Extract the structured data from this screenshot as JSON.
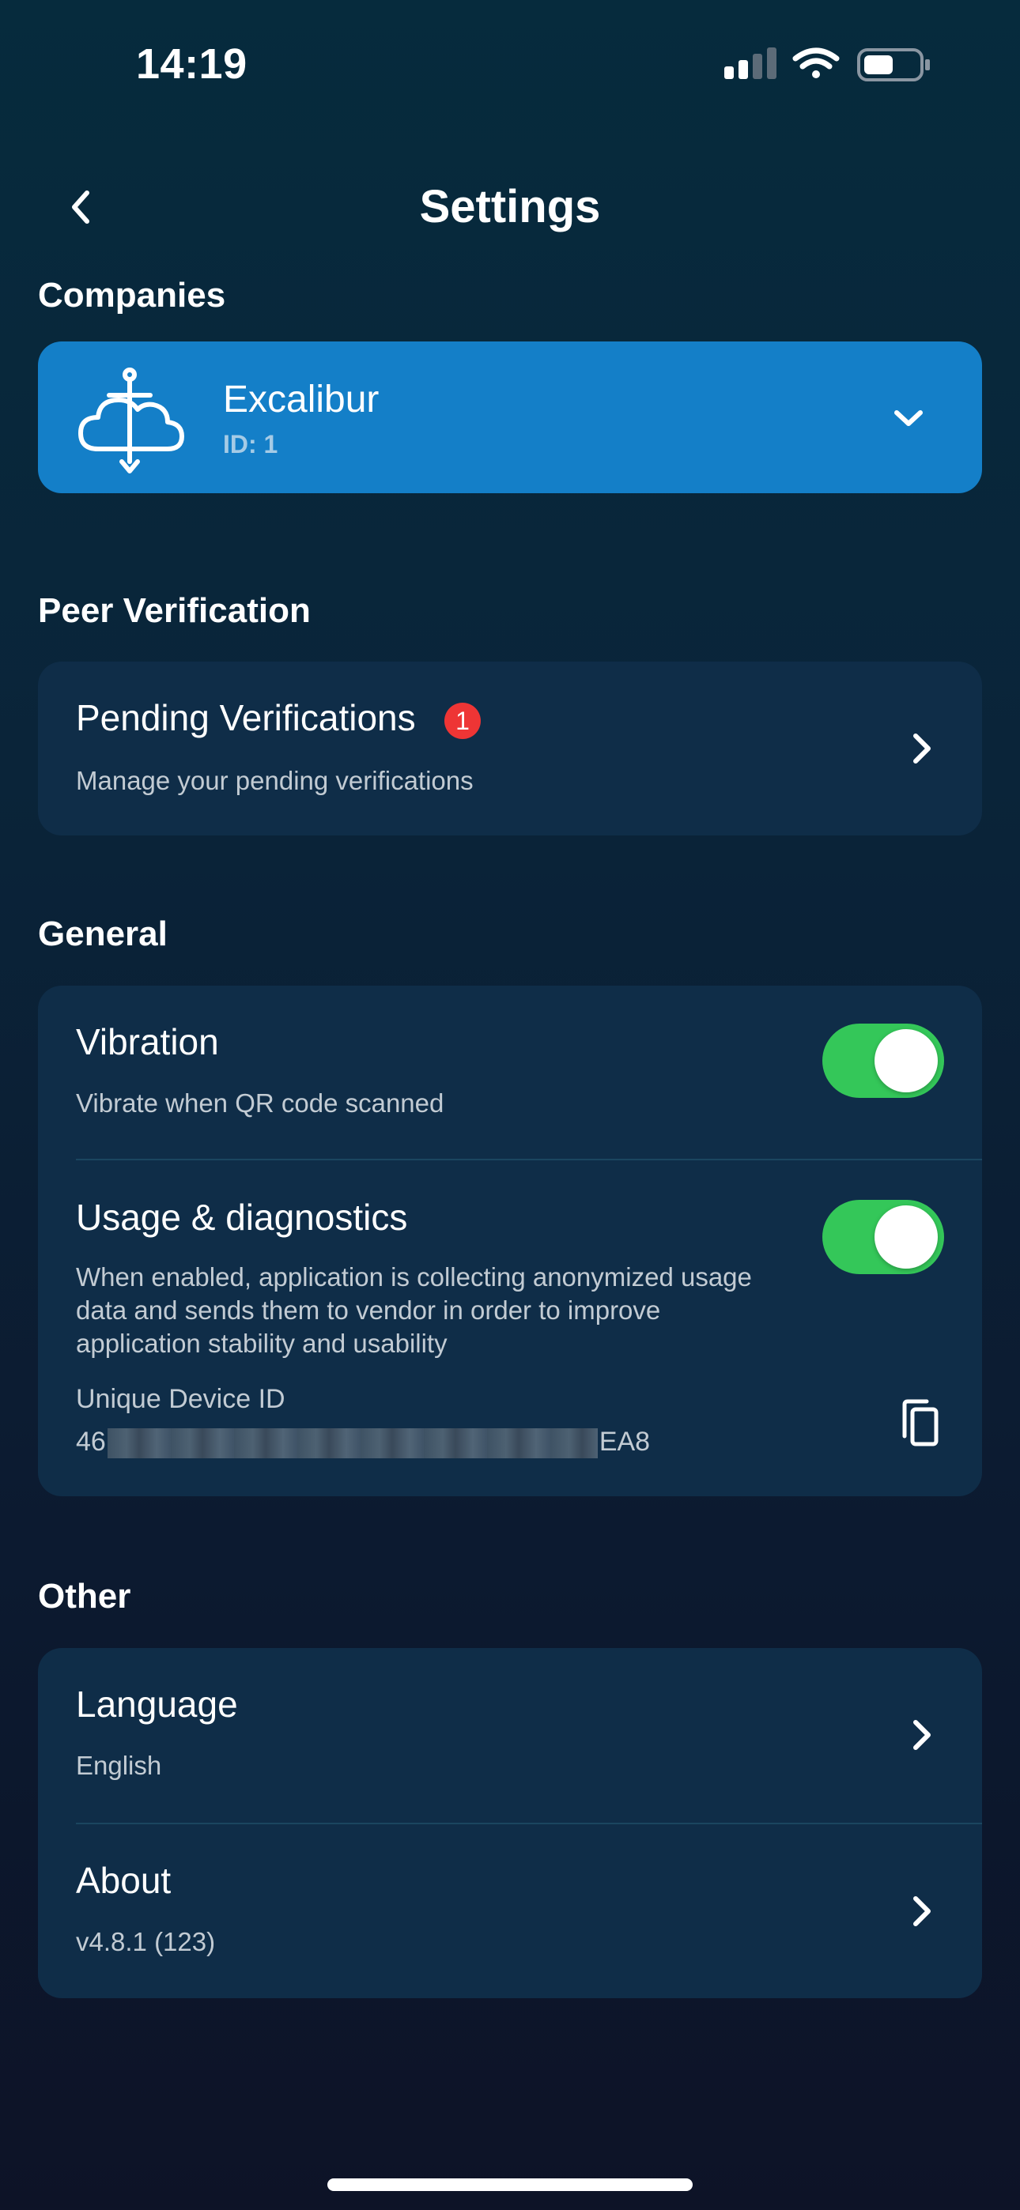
{
  "status_bar": {
    "time": "14:19",
    "icons": [
      "cellular-signal-icon",
      "wifi-icon",
      "battery-icon"
    ]
  },
  "header": {
    "title": "Settings",
    "back_icon": "chevron-left-icon"
  },
  "companies": {
    "section_title": "Companies",
    "selected": {
      "name": "Excalibur",
      "id_label": "ID: 1",
      "logo_icon": "cloud-sword-logo",
      "expand_icon": "chevron-down-icon"
    }
  },
  "peer_verification": {
    "section_title": "Peer Verification",
    "pending": {
      "title": "Pending Verifications",
      "badge_count": "1",
      "subtitle": "Manage your pending verifications"
    }
  },
  "general": {
    "section_title": "General",
    "vibration": {
      "title": "Vibration",
      "subtitle": "Vibrate when QR code scanned",
      "enabled": true
    },
    "usage": {
      "title": "Usage & diagnostics",
      "description": "When enabled, application is collecting anonymized usage data and sends them to vendor in order to improve application stability and usability",
      "enabled": true,
      "device_id_label": "Unique Device ID",
      "device_id_prefix": "46",
      "device_id_suffix": "EA8"
    }
  },
  "other": {
    "section_title": "Other",
    "language": {
      "title": "Language",
      "value": "English"
    },
    "about": {
      "title": "About",
      "value": "v4.8.1 (123)"
    }
  },
  "colors": {
    "accent_blue": "#147fc8",
    "toggle_on": "#34c759",
    "badge_red": "#ee3535",
    "card_bg": "#0f2d48"
  }
}
